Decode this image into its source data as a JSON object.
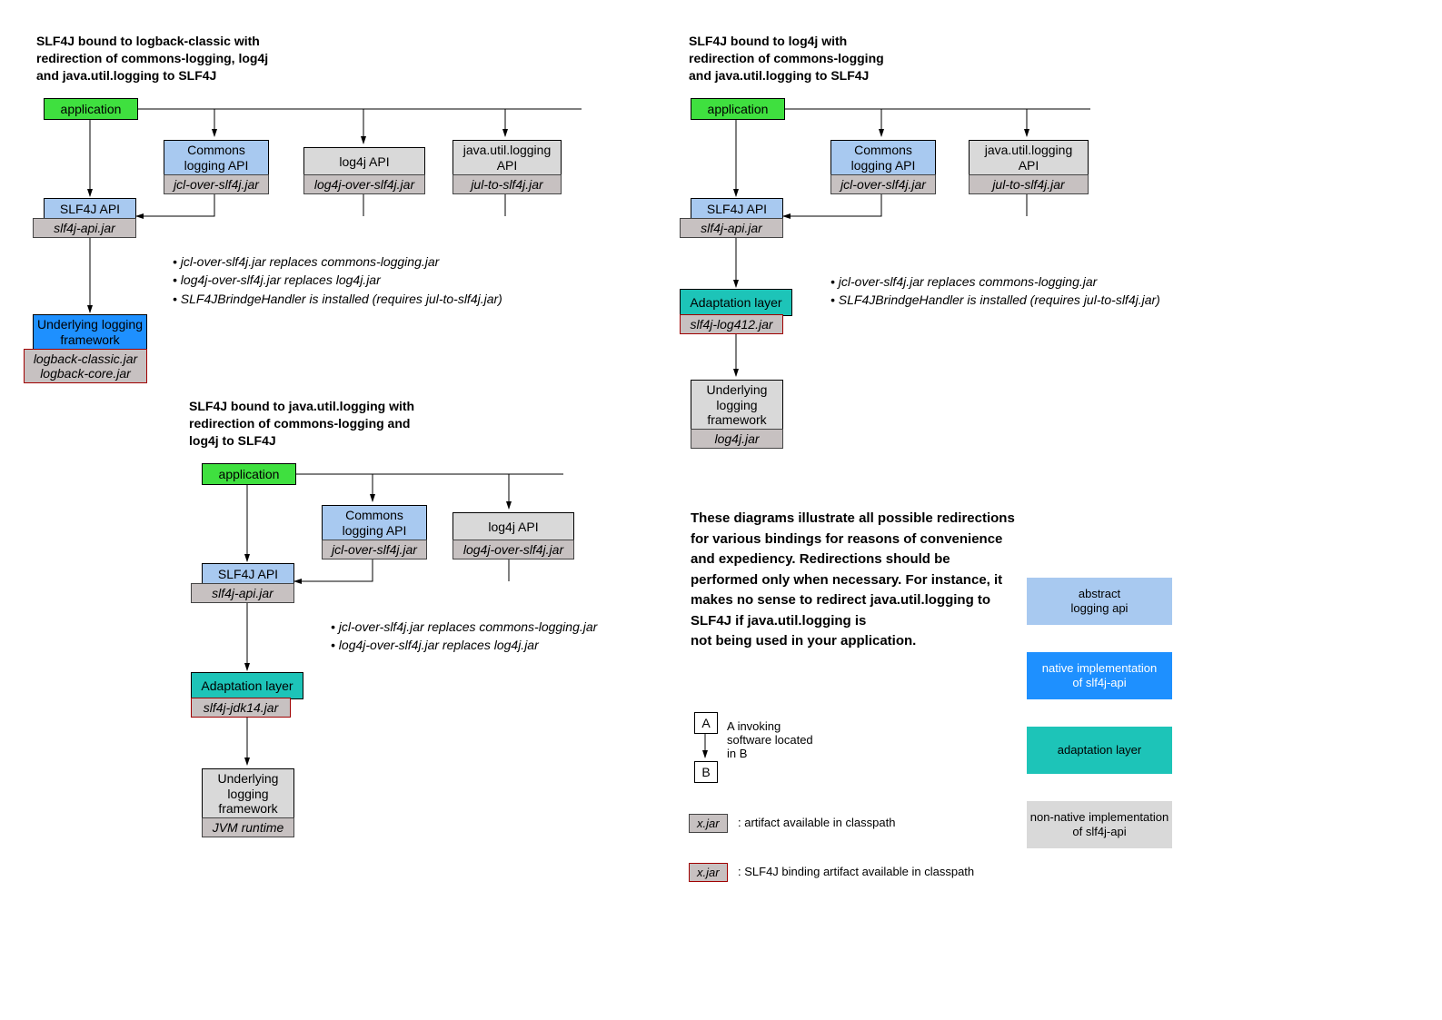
{
  "d1": {
    "title": "SLF4J bound to logback-classic with\nredirection of commons-logging, log4j\nand java.util.logging to SLF4J",
    "app": "application",
    "commons": "Commons\nlogging API",
    "commons_jar": "jcl-over-slf4j.jar",
    "log4j": "log4j API",
    "log4j_jar": "log4j-over-slf4j.jar",
    "jul": "java.util.logging\nAPI",
    "jul_jar": "jul-to-slf4j.jar",
    "slf4j": "SLF4J API",
    "slf4j_jar": "slf4j-api.jar",
    "under": "Underlying logging\nframework",
    "under_jar": "logback-classic.jar\nlogback-core.jar",
    "b1": "jcl-over-slf4j.jar replaces commons-logging.jar",
    "b2": "log4j-over-slf4j.jar replaces log4j.jar",
    "b3": "SLF4JBrindgeHandler is installed (requires jul-to-slf4j.jar)"
  },
  "d2": {
    "title": "SLF4J bound to java.util.logging with\nredirection of commons-logging and\nlog4j to SLF4J",
    "app": "application",
    "commons": "Commons\nlogging API",
    "commons_jar": "jcl-over-slf4j.jar",
    "log4j": "log4j API",
    "log4j_jar": "log4j-over-slf4j.jar",
    "slf4j": "SLF4J API",
    "slf4j_jar": "slf4j-api.jar",
    "adapt": "Adaptation layer",
    "adapt_jar": "slf4j-jdk14.jar",
    "under": "Underlying\nlogging\nframework",
    "under_jar": "JVM runtime",
    "b1": "jcl-over-slf4j.jar replaces commons-logging.jar",
    "b2": "log4j-over-slf4j.jar replaces log4j.jar"
  },
  "d3": {
    "title": "SLF4J bound to log4j with\nredirection of commons-logging\nand java.util.logging to SLF4J",
    "app": "application",
    "commons": "Commons\nlogging API",
    "commons_jar": "jcl-over-slf4j.jar",
    "jul": "java.util.logging\nAPI",
    "jul_jar": "jul-to-slf4j.jar",
    "slf4j": "SLF4J API",
    "slf4j_jar": "slf4j-api.jar",
    "adapt": "Adaptation layer",
    "adapt_jar": "slf4j-log412.jar",
    "under": "Underlying\nlogging\nframework",
    "under_jar": "log4j.jar",
    "b1": "jcl-over-slf4j.jar replaces commons-logging.jar",
    "b2": "SLF4JBrindgeHandler is installed (requires jul-to-slf4j.jar)"
  },
  "note": "These diagrams illustrate all possible redirections for various bindings for reasons of convenience and expediency. Redirections should be performed only when necessary. For instance, it makes no sense to redirect java.util.logging to SLF4J if java.util.logging is\nnot being used in your application.",
  "legend": {
    "a": "A",
    "b": "B",
    "ab": "A invoking\nsoftware located\nin B",
    "xjar": "x.jar",
    "xjar_txt": ": artifact available in classpath",
    "bindjar": "x.jar",
    "bindjar_txt": ": SLF4J binding artifact available in classpath",
    "c1": "abstract\nlogging api",
    "c2": "native implementation\nof slf4j-api",
    "c3": "adaptation layer",
    "c4": "non-native implementation\nof slf4j-api"
  }
}
